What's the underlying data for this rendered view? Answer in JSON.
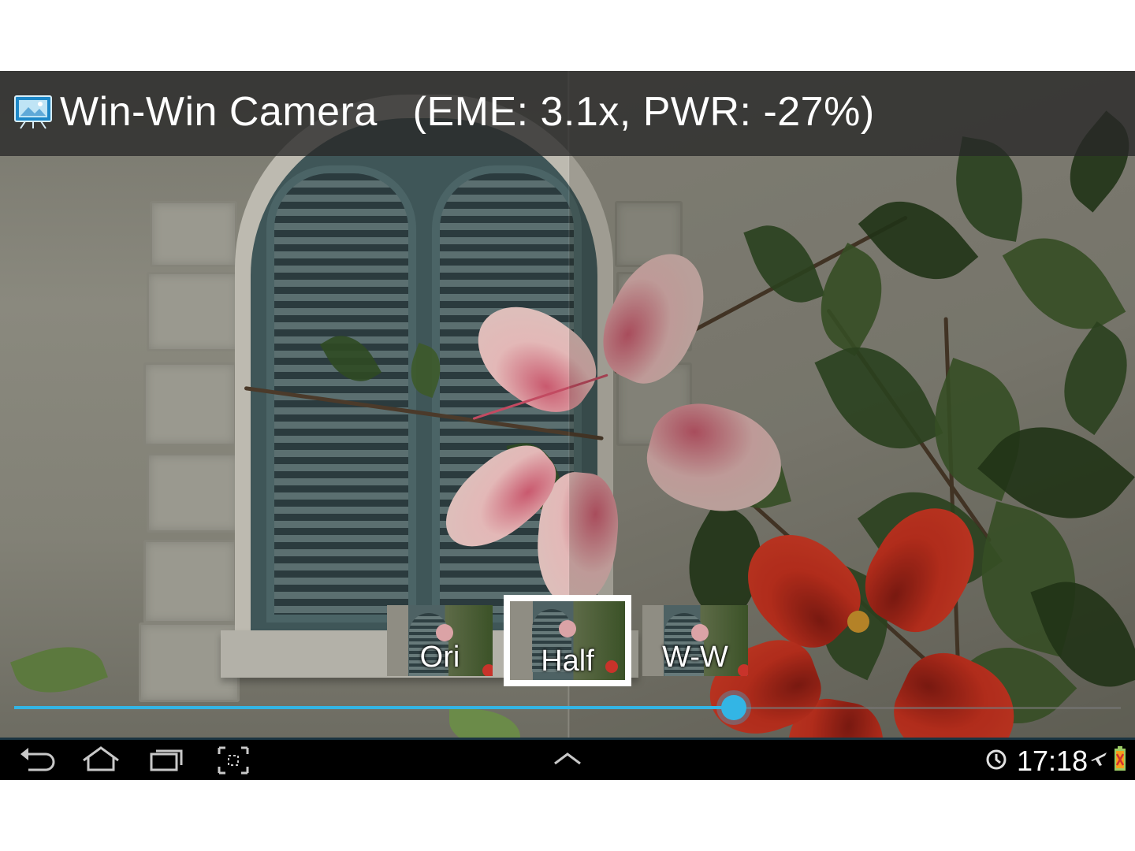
{
  "app": {
    "title": "Win-Win Camera   (EME: 3.1x, PWR: -27%)",
    "icon": "gallery-presentation-icon"
  },
  "modes": [
    {
      "id": "ori",
      "label": "Ori",
      "selected": false
    },
    {
      "id": "half",
      "label": "Half",
      "selected": true
    },
    {
      "id": "ww",
      "label": "W-W",
      "selected": false
    }
  ],
  "slider": {
    "value": 0.65,
    "color": "#33b5e5"
  },
  "systembar": {
    "nav_icons": [
      "back-icon",
      "home-icon",
      "recent-apps-icon",
      "screenshot-icon"
    ],
    "center_icon": "chevron-up-icon",
    "time": "17:18",
    "status_icons": [
      "clock-alarm-icon",
      "airplane-mode-icon",
      "battery-charging-icon"
    ]
  },
  "colors": {
    "accent": "#33b5e5",
    "actionbar": "#282828",
    "systembar": "#000000"
  }
}
